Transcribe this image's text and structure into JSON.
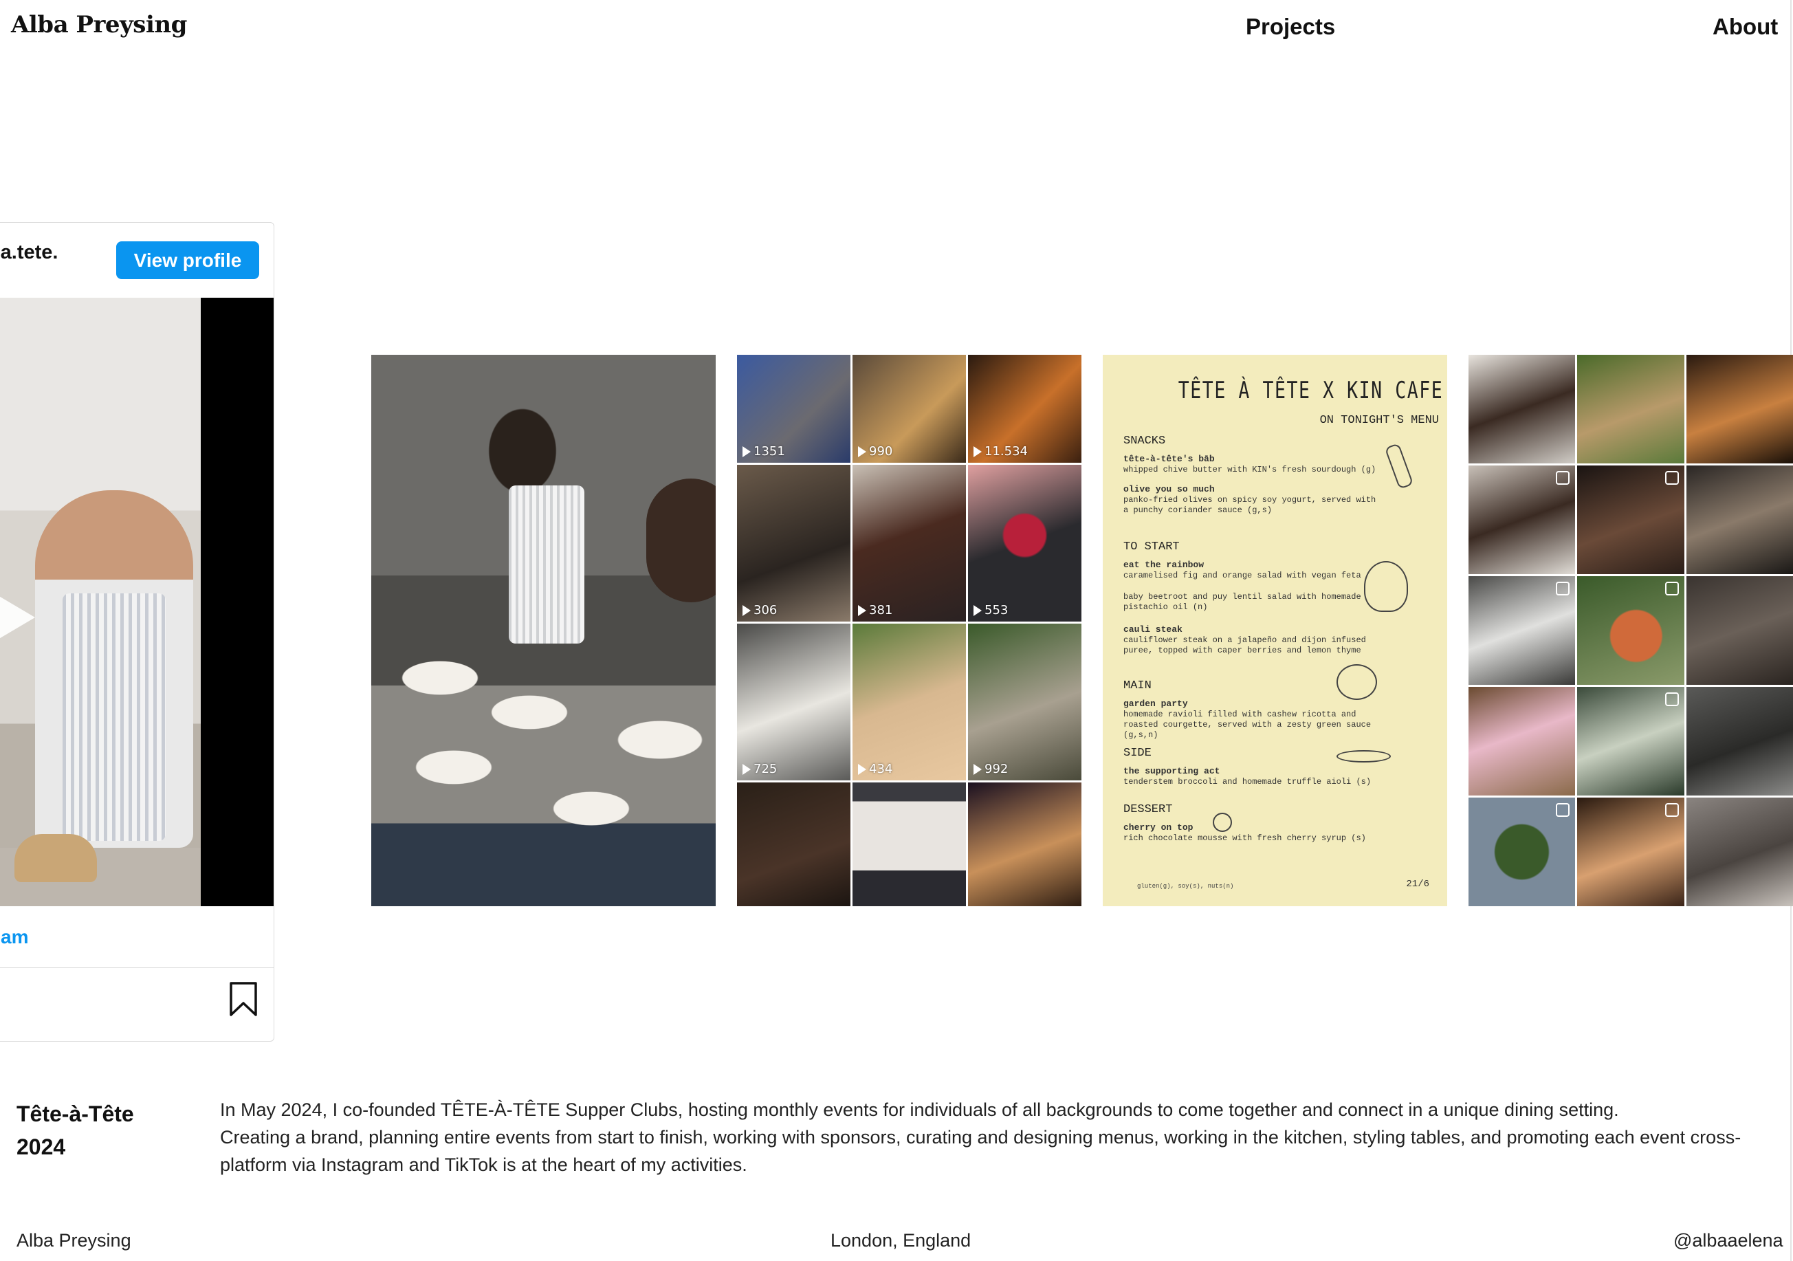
{
  "header": {
    "site_title": "Alba Preysing",
    "nav": {
      "projects": "Projects",
      "about": "About"
    }
  },
  "instagram_embed": {
    "handle": "tete.a.tete.",
    "view_profile_label": "View profile",
    "link_text": "am"
  },
  "gallery": {
    "menu": {
      "title": "TÊTE À TÊTE X KIN CAFE",
      "subtitle": "ON TONIGHT'S MENU",
      "sections": [
        {
          "heading": "SNACKS",
          "items": [
            {
              "name": "tête-à-tête's bāb",
              "desc": "whipped chive butter with KIN's fresh sourdough (g)"
            },
            {
              "name": "olive you so much",
              "desc": "panko-fried olives on spicy soy yogurt, served with a punchy coriander sauce (g,s)"
            }
          ]
        },
        {
          "heading": "TO START",
          "items": [
            {
              "name": "eat the rainbow",
              "desc": "caramelised fig and orange salad with vegan feta"
            },
            {
              "name": "",
              "desc": "baby beetroot and puy lentil salad with homemade pistachio oil (n)"
            },
            {
              "name": "cauli steak",
              "desc": "cauliflower steak on a jalapeño and dijon infused puree, topped with caper berries and lemon thyme"
            }
          ]
        },
        {
          "heading": "MAIN",
          "items": [
            {
              "name": "garden party",
              "desc": "homemade ravioli filled with cashew ricotta and roasted courgette, served with a zesty green sauce (g,s,n)"
            }
          ]
        },
        {
          "heading": "SIDE",
          "items": [
            {
              "name": "the supporting act",
              "desc": "tenderstem broccoli and homemade truffle aioli (s)"
            }
          ]
        },
        {
          "heading": "DESSERT",
          "items": [
            {
              "name": "cherry on top",
              "desc": "rich chocolate mousse with fresh cherry syrup (s)"
            }
          ]
        }
      ],
      "footnote": "gluten(g), soy(s), nuts(n)",
      "page": "21/6"
    },
    "tiktok_counts": [
      "1351",
      "990",
      "11.534",
      "306",
      "381",
      "553",
      "725",
      "434",
      "992"
    ]
  },
  "project": {
    "title": "Tête-à-Tête",
    "year": "2024",
    "description_1": "In May 2024, I co-founded TÊTE-À-TÊTE Supper Clubs, hosting monthly events for individuals of all backgrounds to come together and connect in a unique dining setting.",
    "description_2": "Creating a brand, planning entire events from start to finish, working with sponsors, curating and designing menus, working in the kitchen, styling tables, and promoting each event cross-platform via Instagram and TikTok is at the heart of my activities."
  },
  "footer": {
    "name": "Alba Preysing",
    "location": "London, England",
    "handle": "@albaaelena"
  },
  "colors": {
    "accent": "#0a95f0",
    "menu_bg": "#f3ecbd",
    "text": "#111111"
  }
}
